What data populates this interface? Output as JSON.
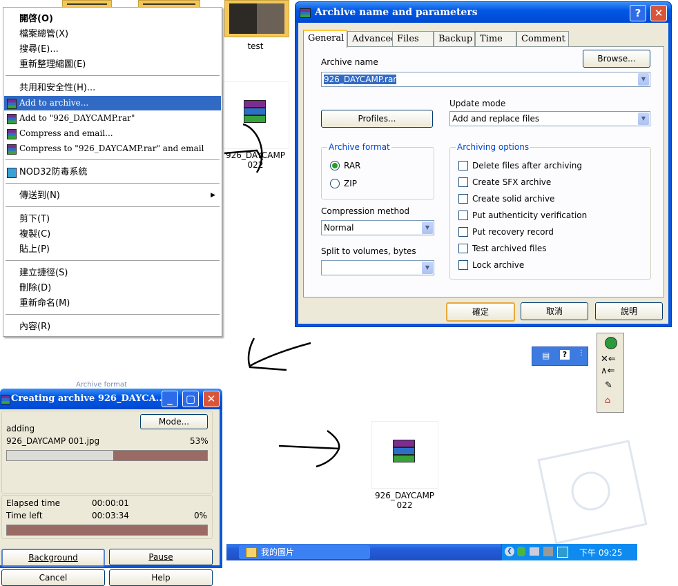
{
  "context_menu": {
    "items": [
      {
        "label": "開啓(O)",
        "bold": true
      },
      {
        "label": "檔案總管(X)"
      },
      {
        "label": "搜尋(E)..."
      },
      {
        "label": "重新整理縮圖(E)"
      },
      {
        "label": "共用和安全性(H)..."
      },
      {
        "label": "Add to archive...",
        "icon": "rar-icon",
        "selected": true
      },
      {
        "label": "Add to \"926_DAYCAMP.rar\"",
        "icon": "rar-icon"
      },
      {
        "label": "Compress and email...",
        "icon": "rar-icon"
      },
      {
        "label": "Compress to \"926_DAYCAMP.rar\" and email",
        "icon": "rar-icon"
      },
      {
        "label": "NOD32防毒系統",
        "icon": "nod32-icon"
      },
      {
        "label": "傳送到(N)",
        "submenu": true
      },
      {
        "label": "剪下(T)"
      },
      {
        "label": "複製(C)"
      },
      {
        "label": "貼上(P)"
      },
      {
        "label": "建立捷徑(S)"
      },
      {
        "label": "刪除(D)"
      },
      {
        "label": "重新命名(M)"
      },
      {
        "label": "內容(R)"
      }
    ]
  },
  "desktop": {
    "thumb_label": "test",
    "file_top_label_1": "926_DAYCAMP",
    "file_top_label_2": "022",
    "file_bottom_label_1": "926_DAYCAMP",
    "file_bottom_label_2": "022"
  },
  "archive_dialog": {
    "title": "Archive name and parameters",
    "help_btn": "?",
    "close_btn": "✕",
    "tabs": [
      "General",
      "Advanced",
      "Files",
      "Backup",
      "Time",
      "Comment"
    ],
    "archive_name_label": "Archive name",
    "browse": "Browse...",
    "archive_name_value": "926_DAYCAMP.rar",
    "profiles": "Profiles...",
    "update_mode_label": "Update mode",
    "update_mode_value": "Add and replace files",
    "format_label": "Archive format",
    "formats": [
      "RAR",
      "ZIP"
    ],
    "compression_label": "Compression method",
    "compression_value": "Normal",
    "split_label": "Split to volumes, bytes",
    "split_value": "",
    "options_label": "Archiving options",
    "options": [
      "Delete files after archiving",
      "Create SFX archive",
      "Create solid archive",
      "Put authenticity verification",
      "Put recovery record",
      "Test archived files",
      "Lock archive"
    ],
    "ok": "確定",
    "cancel": "取消",
    "help": "說明"
  },
  "progress_dialog": {
    "title": "Creating archive 926_DAYCA...",
    "mode": "Mode...",
    "adding": "adding",
    "file": "926_DAYCAMP 001.jpg",
    "file_percent": "53%",
    "file_progress": 0.53,
    "elapsed_label": "Elapsed time",
    "elapsed_value": "00:00:01",
    "left_label": "Time left",
    "left_value": "00:03:34",
    "total_percent": "0%",
    "background": "Background",
    "pause": "Pause",
    "cancel": "Cancel",
    "help": "Help"
  },
  "taskbar": {
    "window": "我的圖片",
    "clock": "下午 09:25"
  },
  "colors": {
    "selection": "#316ac5",
    "titlebar": "#0058e6",
    "accent": "#0046d5"
  }
}
